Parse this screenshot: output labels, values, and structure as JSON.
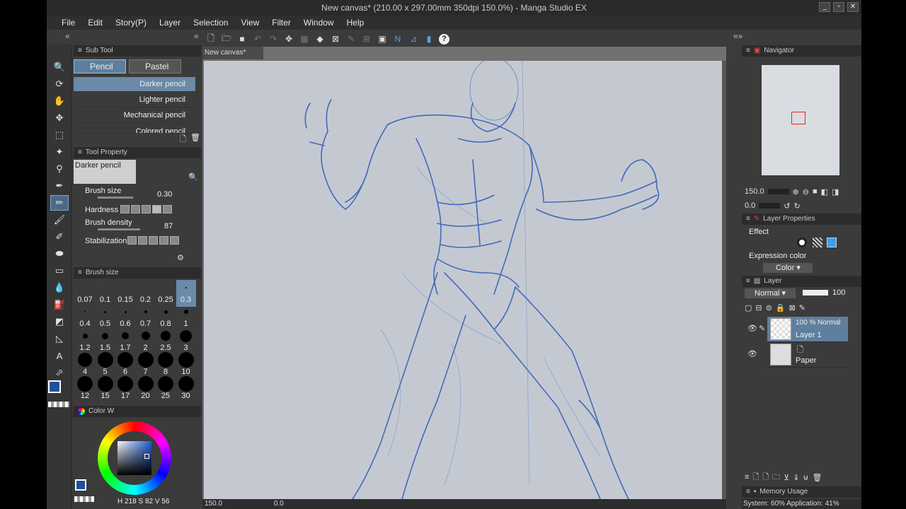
{
  "window": {
    "title": "New canvas* (210.00 x 297.00mm 350dpi 150.0%) - Manga Studio EX"
  },
  "menu": [
    "File",
    "Edit",
    "Story(P)",
    "Layer",
    "Selection",
    "View",
    "Filter",
    "Window",
    "Help"
  ],
  "subtool": {
    "header": "Sub Tool",
    "tabs": [
      "Pencil",
      "Pastel"
    ],
    "brushes": [
      "Darker pencil",
      "Lighter pencil",
      "Mechanical pencil",
      "Colored pencil"
    ]
  },
  "toolprop": {
    "header": "Tool Property",
    "name": "Darker pencil",
    "brush_size_label": "Brush size",
    "brush_size_value": "0.30",
    "hardness_label": "Hardness",
    "brush_density_label": "Brush density",
    "brush_density_value": "87",
    "stabilization_label": "Stabilization"
  },
  "brushsize": {
    "header": "Brush size",
    "items": [
      {
        "label": "0.07",
        "d": 1
      },
      {
        "label": "0.1",
        "d": 1
      },
      {
        "label": "0.15",
        "d": 1
      },
      {
        "label": "0.2",
        "d": 1
      },
      {
        "label": "0.25",
        "d": 1
      },
      {
        "label": "0.3",
        "d": 2
      },
      {
        "label": "0.4",
        "d": 2
      },
      {
        "label": "0.5",
        "d": 3
      },
      {
        "label": "0.6",
        "d": 3
      },
      {
        "label": "0.7",
        "d": 4
      },
      {
        "label": "0.8",
        "d": 5
      },
      {
        "label": "1",
        "d": 6
      },
      {
        "label": "1.2",
        "d": 7
      },
      {
        "label": "1.5",
        "d": 9
      },
      {
        "label": "1.7",
        "d": 10
      },
      {
        "label": "2",
        "d": 12
      },
      {
        "label": "2.5",
        "d": 14
      },
      {
        "label": "3",
        "d": 17
      },
      {
        "label": "4",
        "d": 20
      },
      {
        "label": "5",
        "d": 22
      },
      {
        "label": "6",
        "d": 22
      },
      {
        "label": "7",
        "d": 22
      },
      {
        "label": "8",
        "d": 22
      },
      {
        "label": "10",
        "d": 22
      },
      {
        "label": "12",
        "d": 22
      },
      {
        "label": "15",
        "d": 22
      },
      {
        "label": "17",
        "d": 22
      },
      {
        "label": "20",
        "d": 22
      },
      {
        "label": "25",
        "d": 22
      },
      {
        "label": "30",
        "d": 22
      }
    ]
  },
  "colorpanel": {
    "header": "Color W",
    "h_label": "H",
    "h": "218",
    "s_label": "S",
    "s": "82",
    "v_label": "V",
    "v": "56",
    "main_color": "#1f4fa0"
  },
  "canvas": {
    "tab": "New canvas*",
    "zoom": "150.0",
    "angle": "0.0"
  },
  "navigator": {
    "header": "Navigator",
    "zoom": "150.0",
    "angle": "0.0"
  },
  "layerprops": {
    "header": "Layer Properties",
    "effect_label": "Effect",
    "expression_label": "Expression color",
    "expression_value": "Color"
  },
  "layers": {
    "header": "Layer",
    "blend": "Normal",
    "opacity": "100",
    "items": [
      {
        "meta": "100 %  Normal",
        "name": "Layer 1"
      },
      {
        "meta": "",
        "name": "Paper"
      }
    ]
  },
  "memory": {
    "header": "Memory Usage",
    "text": "System: 60%  Application: 41%"
  }
}
